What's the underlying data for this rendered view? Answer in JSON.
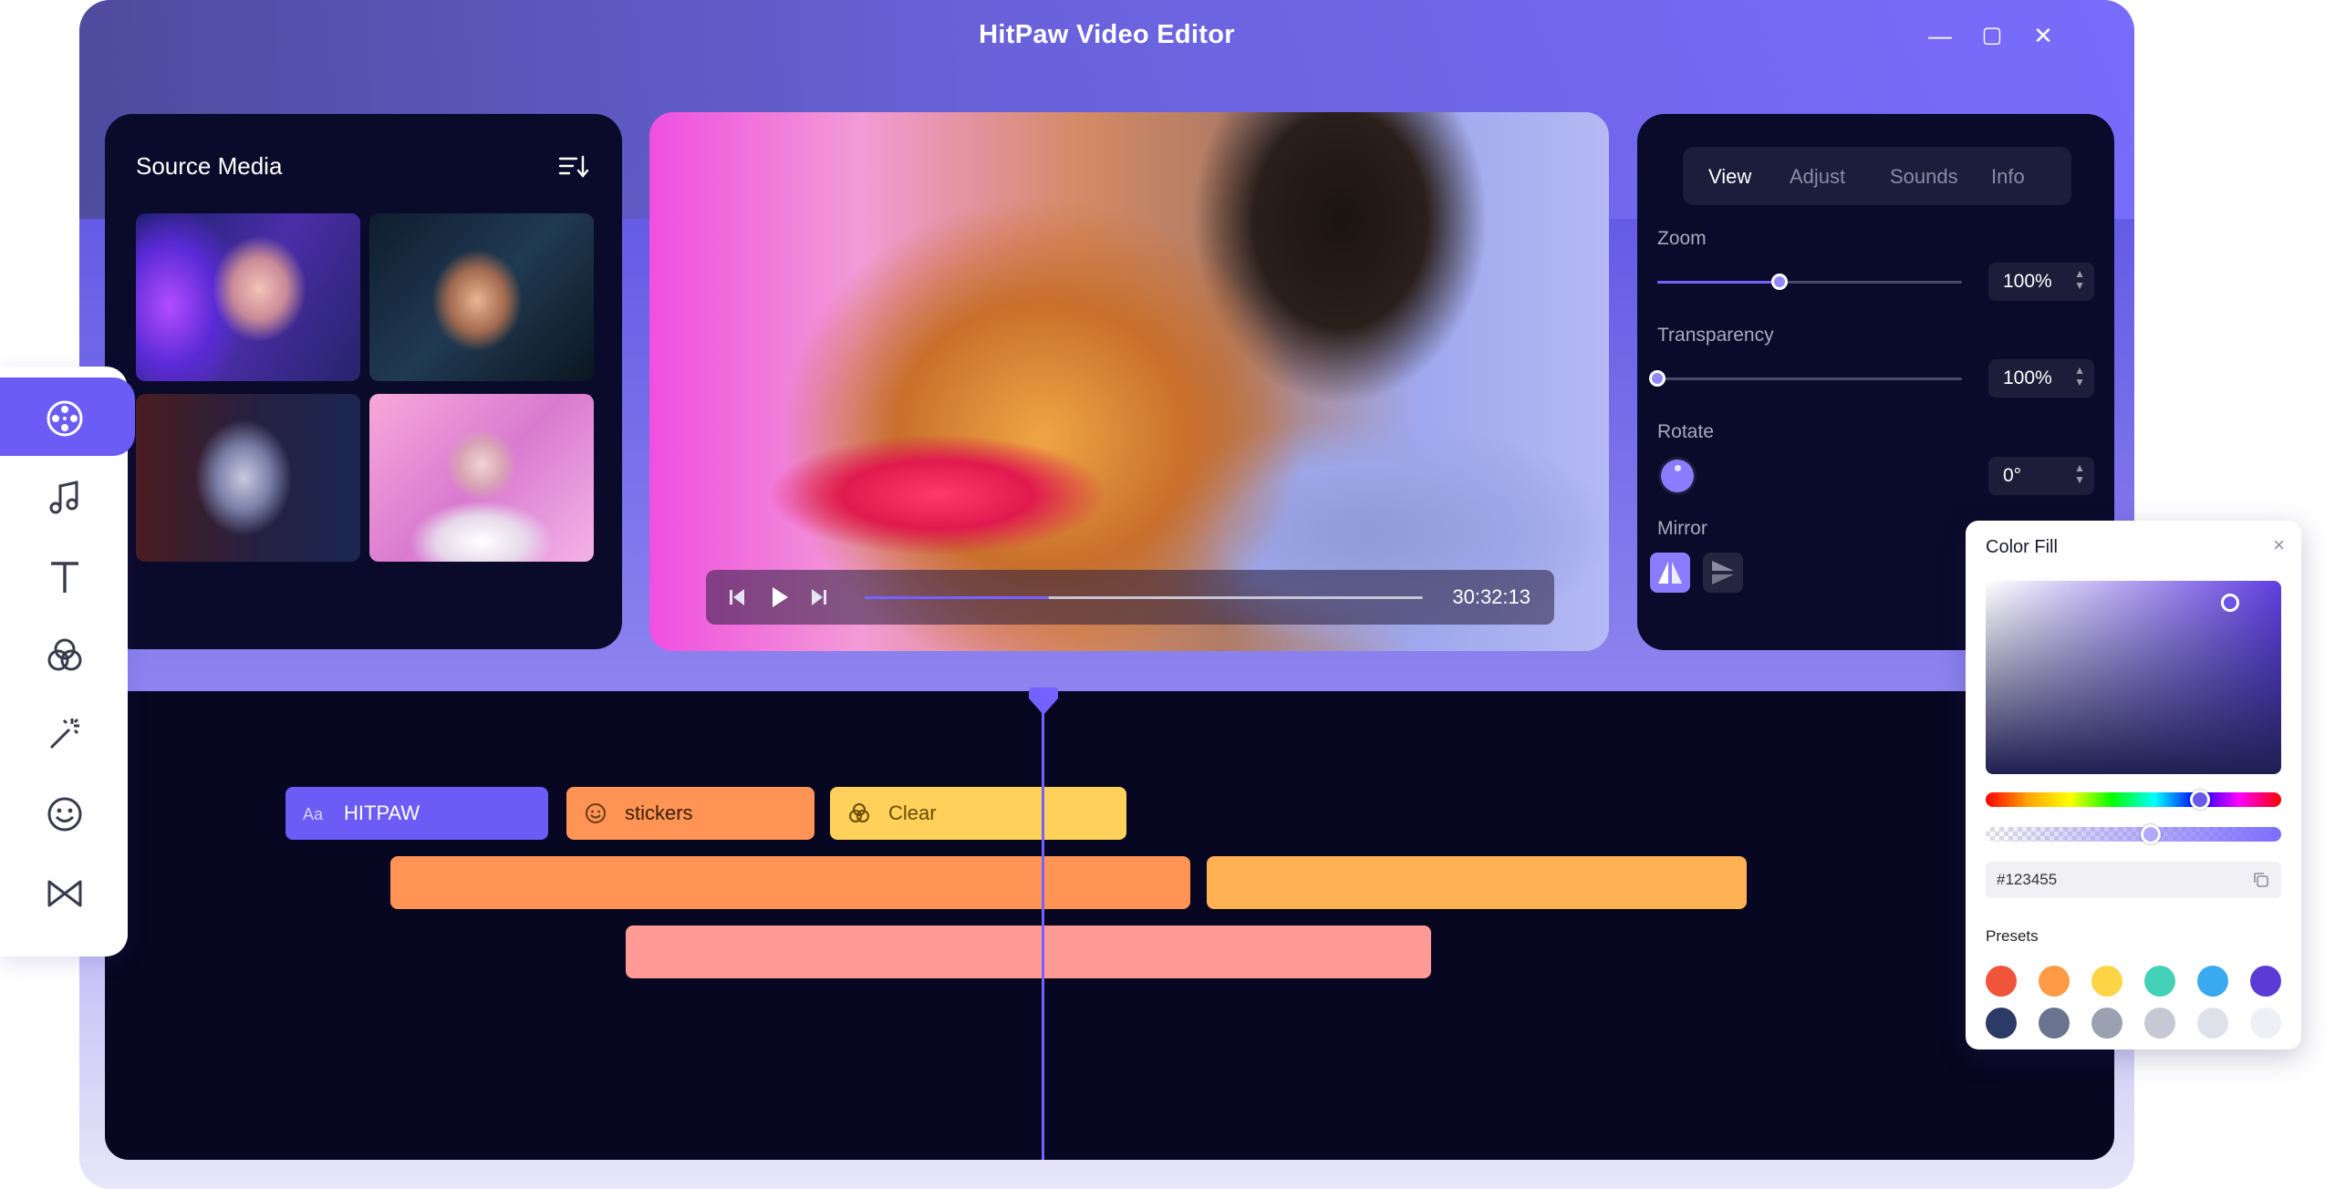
{
  "app": {
    "title": "HitPaw Video Editor",
    "window_buttons": {
      "minimize": "—",
      "maximize": "▢",
      "close": "✕"
    }
  },
  "source_media": {
    "title": "Source Media",
    "sort_icon": "sort-icon",
    "thumbnails": [
      "thumbnail-neon-woman",
      "thumbnail-man-glasses",
      "thumbnail-woman-glasses",
      "thumbnail-pink-woman"
    ]
  },
  "player": {
    "time": "30:32:13",
    "progress": 0.33,
    "icons": [
      "step-back-icon",
      "play-icon",
      "step-forward-icon"
    ]
  },
  "properties": {
    "tabs": [
      {
        "label": "View",
        "active": true
      },
      {
        "label": "Adjust",
        "active": false
      },
      {
        "label": "Sounds",
        "active": false
      },
      {
        "label": "Info",
        "active": false
      }
    ],
    "zoom": {
      "label": "Zoom",
      "value": "100%",
      "slider": 0.4
    },
    "transparency": {
      "label": "Transparency",
      "value": "100%",
      "slider": 0.0
    },
    "rotate": {
      "label": "Rotate",
      "value": "0°"
    },
    "mirror": {
      "label": "Mirror"
    }
  },
  "timeline": {
    "clips": [
      {
        "label": "HITPAW",
        "icon": "text-icon",
        "color": "#6c5cf6"
      },
      {
        "label": "stickers",
        "icon": "sticker-icon",
        "color": "#ff9455"
      },
      {
        "label": "Clear",
        "icon": "filter-icon",
        "color": "#ffd15b"
      }
    ],
    "track_colors": [
      "#ff9455",
      "#ffb153",
      "#ff9a95"
    ]
  },
  "toolbar": {
    "tools": [
      {
        "name": "media-tool",
        "icon": "film-reel-icon",
        "active": true
      },
      {
        "name": "audio-tool",
        "icon": "music-note-icon",
        "active": false
      },
      {
        "name": "text-tool",
        "icon": "text-t-icon",
        "active": false
      },
      {
        "name": "filter-tool",
        "icon": "filter-circles-icon",
        "active": false
      },
      {
        "name": "effects-tool",
        "icon": "magic-wand-icon",
        "active": false
      },
      {
        "name": "stickers-tool",
        "icon": "sticker-face-icon",
        "active": false
      },
      {
        "name": "transitions-tool",
        "icon": "bowtie-icon",
        "active": false
      }
    ]
  },
  "color_fill": {
    "title": "Color Fill",
    "close": "×",
    "hex": "#123455",
    "presets_label": "Presets",
    "presets": [
      "#f0553c",
      "#ff9b47",
      "#fcd446",
      "#44d1b7",
      "#39a9f0",
      "#5b3bd6",
      "#2b3a66",
      "#6a748e",
      "#9aa1b0",
      "#c6c8d3",
      "#dfe1ea",
      "#eef0f5"
    ]
  }
}
